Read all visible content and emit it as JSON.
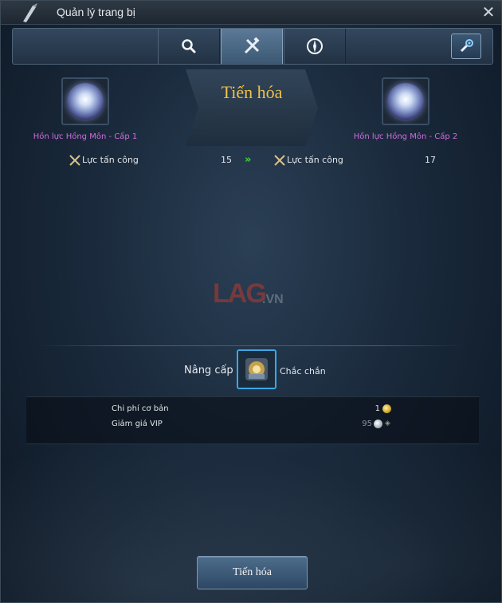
{
  "window": {
    "title": "Quản lý trang bị",
    "close_icon": "close-icon"
  },
  "tabs": [
    {
      "name": "search-tab",
      "icon": "search-icon",
      "active": false
    },
    {
      "name": "forge-tab",
      "icon": "crossed-tools-icon",
      "active": true
    },
    {
      "name": "enchant-tab",
      "icon": "enchant-icon",
      "active": false
    }
  ],
  "side_button": {
    "icon": "wrench-settings-icon"
  },
  "evolve": {
    "banner_text": "Tiến hóa",
    "from_item": {
      "name": "Hồn lực Hồng Môn - Cấp 1",
      "icon": "spirit-orb-icon"
    },
    "to_item": {
      "name": "Hồn lực Hồng Môn - Cấp 2",
      "icon": "spirit-orb-icon"
    },
    "stat_from": {
      "label": "Lực tấn công",
      "value": "15"
    },
    "stat_to": {
      "label": "Lực tấn công",
      "value": "17"
    },
    "arrow_icon": "double-chevron-right-icon"
  },
  "watermark": {
    "brand": "LAG",
    "suffix": ".VN"
  },
  "upgrade": {
    "label": "Nâng cấp",
    "item_icon": "upgrade-scroll-icon",
    "state": "Chắc chắn"
  },
  "costs": [
    {
      "label": "Chi phí cơ bản",
      "value": "1",
      "icon": "gold-coin-icon"
    },
    {
      "label": "Giảm giá VIP",
      "value": "95",
      "icon": "silver-coin-icon"
    }
  ],
  "action_button": {
    "label": "Tiến hóa"
  },
  "colors": {
    "item_name": "#d06be0",
    "banner_text": "#f0c24a",
    "arrow": "#3ed43b",
    "active_slot_border": "#39a8e6"
  }
}
